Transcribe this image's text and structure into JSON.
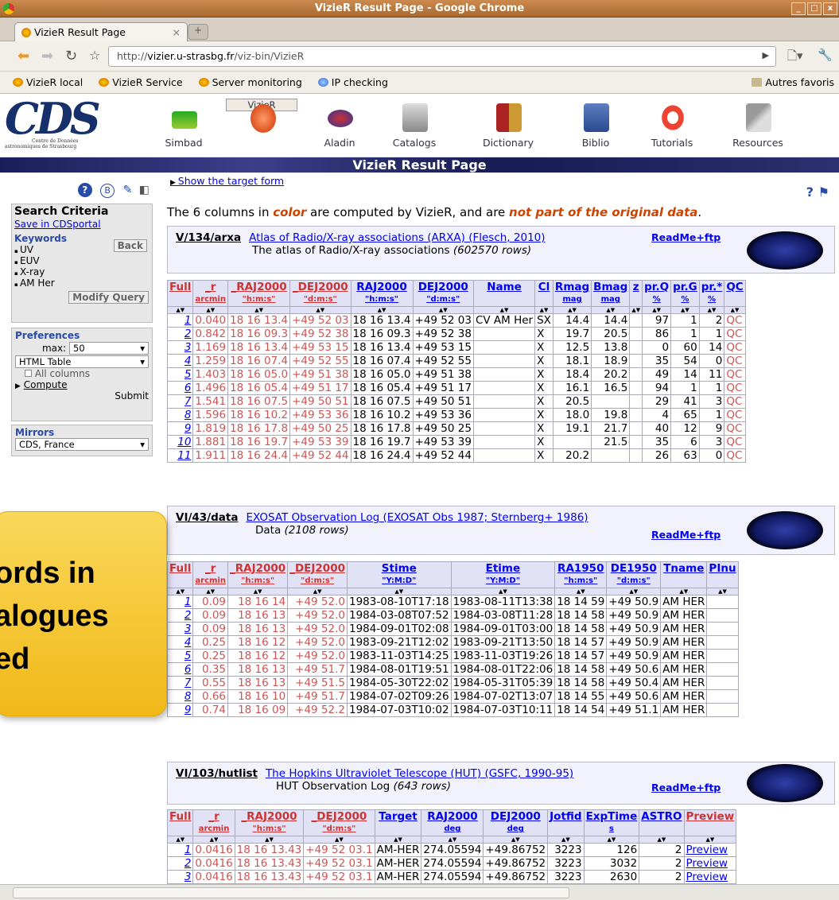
{
  "window": {
    "title": "VizieR Result Page - Google Chrome"
  },
  "tab": {
    "label": "VizieR Result Page"
  },
  "omnibox": {
    "prefix": "http://",
    "host": "vizier.u-strasbg.fr",
    "path": "/viz-bin/VizieR"
  },
  "bookmarks": [
    "VizieR local",
    "VizieR Service",
    "Server monitoring",
    "IP checking"
  ],
  "bookmarks_other": "Autres favoris",
  "cds": {
    "logo": "CDS",
    "logo_sub": [
      "Centre de Données",
      "astronomiques de Strasbourg"
    ],
    "nav": [
      "Simbad",
      "VizieR",
      "Aladin",
      "Catalogs",
      "Dictionary",
      "Biblio",
      "Tutorials",
      "Resources"
    ],
    "banner": "VizieR Result Page"
  },
  "sidebar": {
    "search_criteria": "Search Criteria",
    "save_link": "Save in CDSportal",
    "keywords_label": "Keywords",
    "back": "Back",
    "keywords": [
      "UV",
      "EUV",
      "X-ray",
      "AM Her"
    ],
    "modify": "Modify Query",
    "preferences": "Preferences",
    "max_label": "max:",
    "max_value": "50",
    "format": "HTML Table",
    "all_columns": "All columns",
    "compute": "Compute",
    "submit": "Submit",
    "mirrors": "Mirrors",
    "mirror_value": "CDS, France"
  },
  "main": {
    "show_form": "Show the target form",
    "info_pre": "The 6 columns in ",
    "info_color": "color",
    "info_mid": " are computed by VizieR, and are ",
    "info_not": "not part of the original data",
    "info_end": "."
  },
  "catalogs": [
    {
      "code": "V/134/arxa",
      "title": "Atlas of Radio/X-ray associations (ARXA) (Flesch, 2010)",
      "readme": "ReadMe+ftp",
      "desc": "The atlas of Radio/X-ray associations",
      "rows": "(602570 rows)"
    },
    {
      "code": "VI/43/data",
      "title": "EXOSAT Observation Log (EXOSAT Obs 1987; Sternberg+ 1986)",
      "readme": "ReadMe+ftp",
      "desc": "Data",
      "rows": "(2108 rows)"
    },
    {
      "code": "VI/103/hutlist",
      "title": "The Hopkins Ultraviolet Telescope (HUT) (GSFC, 1990-95)",
      "readme": "ReadMe+ftp",
      "desc": "HUT Observation Log",
      "rows": "(643 rows)"
    }
  ],
  "table1": {
    "headers": [
      [
        "Full",
        ""
      ],
      [
        "_r",
        "arcmin"
      ],
      [
        "_RAJ2000",
        "\"h:m:s\""
      ],
      [
        "_DEJ2000",
        "\"d:m:s\""
      ],
      [
        "RAJ2000",
        "\"h:m:s\""
      ],
      [
        "DEJ2000",
        "\"d:m:s\""
      ],
      [
        "Name",
        ""
      ],
      [
        "Cl",
        ""
      ],
      [
        "Rmag",
        "mag"
      ],
      [
        "Bmag",
        "mag"
      ],
      [
        "z",
        ""
      ],
      [
        "pr.Q",
        "%"
      ],
      [
        "pr.G",
        "%"
      ],
      [
        "pr.*",
        "%"
      ],
      [
        "QC",
        ""
      ]
    ],
    "rows": [
      [
        "1",
        "0.040",
        "18 16 13.4",
        "+49 52 03",
        "18 16 13.4",
        "+49 52 03",
        "CV AM Her",
        "SX",
        "14.4",
        "14.4",
        "",
        "97",
        "1",
        "2",
        "QC"
      ],
      [
        "2",
        "0.842",
        "18 16 09.3",
        "+49 52 38",
        "18 16 09.3",
        "+49 52 38",
        "",
        "X",
        "19.7",
        "20.5",
        "",
        "86",
        "1",
        "1",
        "QC"
      ],
      [
        "3",
        "1.169",
        "18 16 13.4",
        "+49 53 15",
        "18 16 13.4",
        "+49 53 15",
        "",
        "X",
        "12.5",
        "13.8",
        "",
        "0",
        "60",
        "14",
        "QC"
      ],
      [
        "4",
        "1.259",
        "18 16 07.4",
        "+49 52 55",
        "18 16 07.4",
        "+49 52 55",
        "",
        "X",
        "18.1",
        "18.9",
        "",
        "35",
        "54",
        "0",
        "QC"
      ],
      [
        "5",
        "1.403",
        "18 16 05.0",
        "+49 51 38",
        "18 16 05.0",
        "+49 51 38",
        "",
        "X",
        "18.4",
        "20.2",
        "",
        "49",
        "14",
        "11",
        "QC"
      ],
      [
        "6",
        "1.496",
        "18 16 05.4",
        "+49 51 17",
        "18 16 05.4",
        "+49 51 17",
        "",
        "X",
        "16.1",
        "16.5",
        "",
        "94",
        "1",
        "1",
        "QC"
      ],
      [
        "7",
        "1.541",
        "18 16 07.5",
        "+49 50 51",
        "18 16 07.5",
        "+49 50 51",
        "",
        "X",
        "20.5",
        "",
        "",
        "29",
        "41",
        "3",
        "QC"
      ],
      [
        "8",
        "1.596",
        "18 16 10.2",
        "+49 53 36",
        "18 16 10.2",
        "+49 53 36",
        "",
        "X",
        "18.0",
        "19.8",
        "",
        "4",
        "65",
        "1",
        "QC"
      ],
      [
        "9",
        "1.819",
        "18 16 17.8",
        "+49 50 25",
        "18 16 17.8",
        "+49 50 25",
        "",
        "X",
        "19.1",
        "21.7",
        "",
        "40",
        "12",
        "9",
        "QC"
      ],
      [
        "10",
        "1.881",
        "18 16 19.7",
        "+49 53 39",
        "18 16 19.7",
        "+49 53 39",
        "",
        "X",
        "",
        "21.5",
        "",
        "35",
        "6",
        "3",
        "QC"
      ],
      [
        "11",
        "1.911",
        "18 16 24.4",
        "+49 52 44",
        "18 16 24.4",
        "+49 52 44",
        "",
        "X",
        "20.2",
        "",
        "",
        "26",
        "63",
        "0",
        "QC"
      ]
    ]
  },
  "table2": {
    "headers": [
      [
        "Full",
        ""
      ],
      [
        "_r",
        "arcmin"
      ],
      [
        "_RAJ2000",
        "\"h:m:s\""
      ],
      [
        "_DEJ2000",
        "\"d:m:s\""
      ],
      [
        "Stime",
        "\"Y:M:D\""
      ],
      [
        "Etime",
        "\"Y:M:D\""
      ],
      [
        "RA1950",
        "\"h:m:s\""
      ],
      [
        "DE1950",
        "\"d:m:s\""
      ],
      [
        "Tname",
        ""
      ],
      [
        "PInu",
        ""
      ]
    ],
    "rows": [
      [
        "1",
        "0.09",
        "18 16 14",
        "+49 52.0",
        "1983-08-10T17:18",
        "1983-08-11T13:38",
        "18 14 59",
        "+49 50.9",
        "AM HER",
        ""
      ],
      [
        "2",
        "0.09",
        "18 16 13",
        "+49 52.0",
        "1984-03-08T07:52",
        "1984-03-08T11:28",
        "18 14 58",
        "+49 50.9",
        "AM HER",
        ""
      ],
      [
        "3",
        "0.09",
        "18 16 13",
        "+49 52.0",
        "1984-09-01T02:08",
        "1984-09-01T03:00",
        "18 14 58",
        "+49 50.9",
        "AM HER",
        ""
      ],
      [
        "4",
        "0.25",
        "18 16 12",
        "+49 52.0",
        "1983-09-21T12:02",
        "1983-09-21T13:50",
        "18 14 57",
        "+49 50.9",
        "AM HER",
        ""
      ],
      [
        "5",
        "0.25",
        "18 16 12",
        "+49 52.0",
        "1983-11-03T14:25",
        "1983-11-03T19:26",
        "18 14 57",
        "+49 50.9",
        "AM HER",
        ""
      ],
      [
        "6",
        "0.35",
        "18 16 13",
        "+49 51.7",
        "1984-08-01T19:51",
        "1984-08-01T22:06",
        "18 14 58",
        "+49 50.6",
        "AM HER",
        ""
      ],
      [
        "7",
        "0.55",
        "18 16 13",
        "+49 51.5",
        "1984-05-30T22:02",
        "1984-05-31T05:39",
        "18 14 58",
        "+49 50.4",
        "AM HER",
        ""
      ],
      [
        "8",
        "0.66",
        "18 16 10",
        "+49 51.7",
        "1984-07-02T09:26",
        "1984-07-02T13:07",
        "18 14 55",
        "+49 50.6",
        "AM HER",
        ""
      ],
      [
        "9",
        "0.74",
        "18 16 09",
        "+49 52.2",
        "1984-07-03T10:02",
        "1984-07-03T10:11",
        "18 14 54",
        "+49 51.1",
        "AM HER",
        ""
      ]
    ]
  },
  "table3": {
    "headers": [
      [
        "Full",
        ""
      ],
      [
        "_r",
        "arcmin"
      ],
      [
        "_RAJ2000",
        "\"h:m:s\""
      ],
      [
        "_DEJ2000",
        "\"d:m:s\""
      ],
      [
        "Target",
        ""
      ],
      [
        "RAJ2000",
        "deg"
      ],
      [
        "DEJ2000",
        "deg"
      ],
      [
        "Jotfid",
        ""
      ],
      [
        "ExpTime",
        "s"
      ],
      [
        "ASTRO",
        ""
      ],
      [
        "Preview",
        ""
      ]
    ],
    "rows": [
      [
        "1",
        "0.0416",
        "18 16 13.43",
        "+49 52 03.1",
        "AM-HER",
        "274.05594",
        "+49.86752",
        "3223",
        "126",
        "2",
        "Preview"
      ],
      [
        "2",
        "0.0416",
        "18 16 13.43",
        "+49 52 03.1",
        "AM-HER",
        "274.05594",
        "+49.86752",
        "3223",
        "3032",
        "2",
        "Preview"
      ],
      [
        "3",
        "0.0416",
        "18 16 13.43",
        "+49 52 03.1",
        "AM-HER",
        "274.05594",
        "+49.86752",
        "3223",
        "2630",
        "2",
        "Preview"
      ]
    ]
  },
  "callout": [
    "ords in",
    "alogues",
    "ed"
  ],
  "colors": {
    "computed": "#cc4444",
    "link": "#0000ee",
    "header_bg": "#e2e2f6",
    "callout": "#f4c32f"
  }
}
